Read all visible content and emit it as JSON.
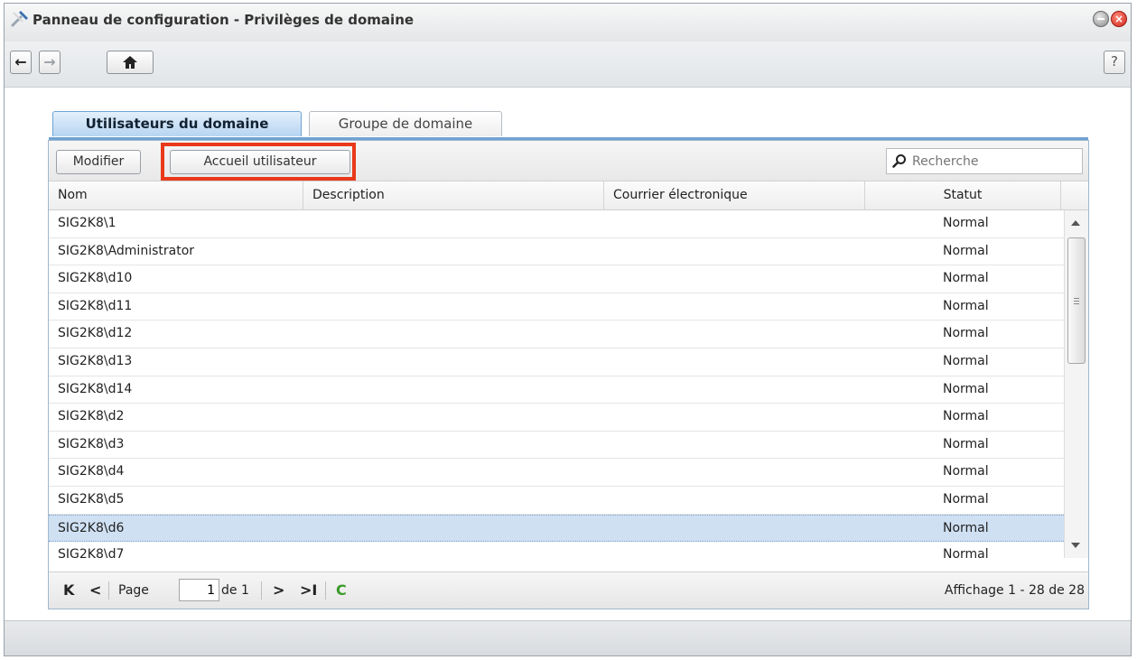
{
  "window": {
    "title": "Panneau de configuration - Privilèges de domaine",
    "title_icon": "tools-icon"
  },
  "toolbar": {
    "back": "←",
    "forward": "→",
    "home": "⌂",
    "help": "?"
  },
  "tabs": [
    {
      "label": "Utilisateurs du domaine",
      "active": true
    },
    {
      "label": "Groupe de domaine",
      "active": false
    }
  ],
  "actions": {
    "modify_label": "Modifier",
    "user_home_label": "Accueil utilisateur",
    "search_placeholder": "Recherche"
  },
  "columns": [
    "Nom",
    "Description",
    "Courrier électronique",
    "Statut"
  ],
  "rows": [
    {
      "name": "SIG2K8\\1",
      "description": "",
      "email": "",
      "status": "Normal"
    },
    {
      "name": "SIG2K8\\Administrator",
      "description": "",
      "email": "",
      "status": "Normal"
    },
    {
      "name": "SIG2K8\\d10",
      "description": "",
      "email": "",
      "status": "Normal"
    },
    {
      "name": "SIG2K8\\d11",
      "description": "",
      "email": "",
      "status": "Normal"
    },
    {
      "name": "SIG2K8\\d12",
      "description": "",
      "email": "",
      "status": "Normal"
    },
    {
      "name": "SIG2K8\\d13",
      "description": "",
      "email": "",
      "status": "Normal"
    },
    {
      "name": "SIG2K8\\d14",
      "description": "",
      "email": "",
      "status": "Normal"
    },
    {
      "name": "SIG2K8\\d2",
      "description": "",
      "email": "",
      "status": "Normal"
    },
    {
      "name": "SIG2K8\\d3",
      "description": "",
      "email": "",
      "status": "Normal"
    },
    {
      "name": "SIG2K8\\d4",
      "description": "",
      "email": "",
      "status": "Normal"
    },
    {
      "name": "SIG2K8\\d5",
      "description": "",
      "email": "",
      "status": "Normal"
    },
    {
      "name": "SIG2K8\\d6",
      "description": "",
      "email": "",
      "status": "Normal",
      "selected": true
    },
    {
      "name": "SIG2K8\\d7",
      "description": "",
      "email": "",
      "status": "Normal"
    }
  ],
  "pager": {
    "first": "K",
    "prev": "<",
    "page_label": "Page",
    "page_value": "1",
    "of_label": "de 1",
    "next": ">",
    "last": ">I",
    "refresh": "C",
    "display_text": "Affichage 1 - 28 de 28"
  },
  "colors": {
    "accent": "#6fa3d2",
    "highlight_border": "#e8391a",
    "selected_row": "#cfe0f3",
    "refresh_green": "#3a9a2a"
  }
}
